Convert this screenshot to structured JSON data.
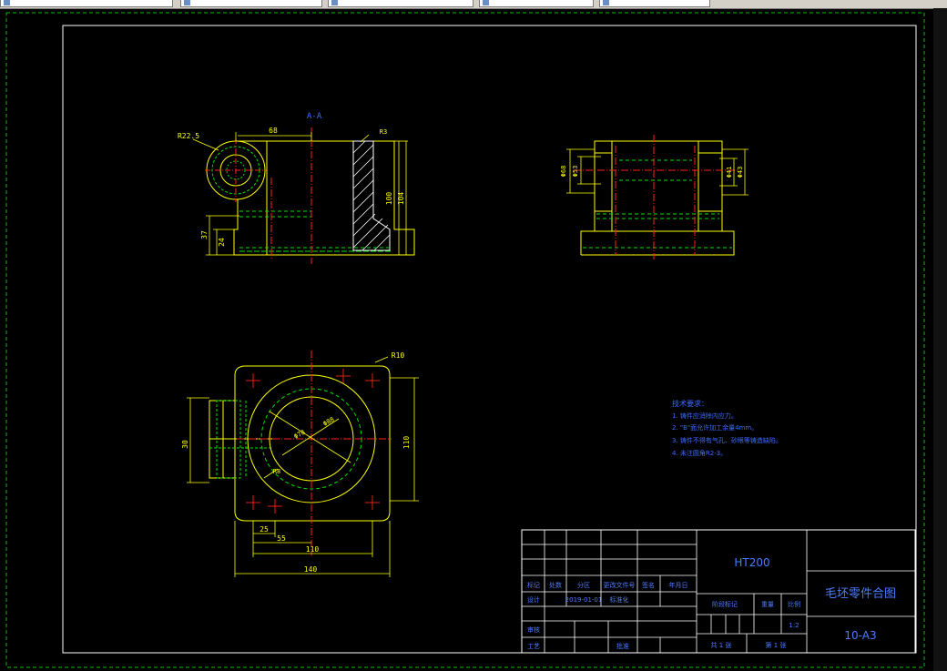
{
  "tabs": [
    {
      "label": "",
      "active": true
    },
    {
      "label": "",
      "active": false
    },
    {
      "label": "",
      "active": false
    },
    {
      "label": "",
      "active": false
    },
    {
      "label": "",
      "active": false
    }
  ],
  "colors": {
    "background": "#000000",
    "border_green": "#00c000",
    "frame": "#ffffff",
    "geometry": "#ffff00",
    "hidden": "#00e000",
    "centerline": "#ff2020",
    "hatch": "#ffffff",
    "notes": "#3a6bff",
    "titleblock": "#4a7cff"
  },
  "views": {
    "section_label": "A-A",
    "front_dims": [
      "R22.5",
      "68",
      "R3",
      "100",
      "104",
      "37",
      "24"
    ],
    "side_dims": [
      "Φ68",
      "Φ53",
      "Φ41",
      "Φ43"
    ],
    "plan_dims": [
      "R10",
      "Φ78",
      "Φ88",
      "R8",
      "30",
      "110",
      "25",
      "55",
      "110",
      "140"
    ]
  },
  "notes": {
    "title": "技术要求：",
    "items": [
      "1. 铸件应消除内应力。",
      "2. \"B\"面允许加工余量4mm。",
      "3. 铸件不得有气孔、砂眼等铸造缺陷。",
      "4. 未注圆角R2-3。"
    ]
  },
  "title_block": {
    "material": "HT200",
    "drawing_title": "毛坯零件合图",
    "drawing_no": "10-A3",
    "labels": {
      "mark": "标记",
      "count": "处数",
      "zone": "分区",
      "change_doc": "更改文件号",
      "sign": "签名",
      "date_label": "年月日",
      "design": "设计",
      "standardize": "标准化",
      "review": "审核",
      "process": "工艺",
      "approve": "批准",
      "stage_mark": "阶段标记",
      "weight": "重量",
      "scale": "比例",
      "sheet_total": "共 1 张",
      "sheet_no": "第 1 张",
      "scale_value": "1:2"
    },
    "date": "2019-01-01"
  }
}
